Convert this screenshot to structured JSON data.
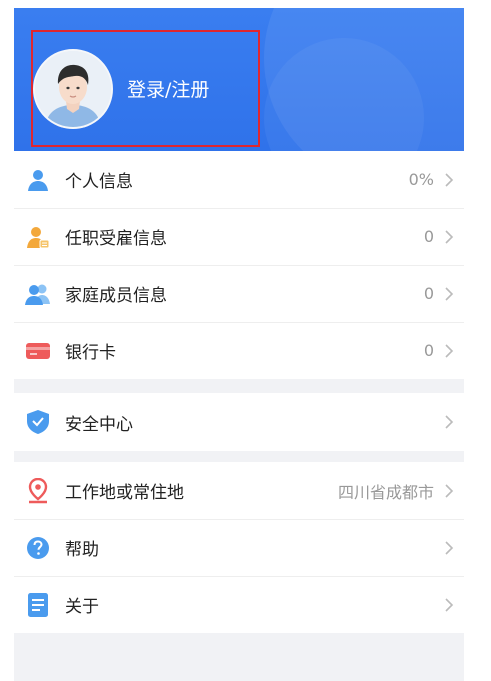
{
  "header": {
    "login_label": "登录/注册"
  },
  "groups": [
    {
      "items": [
        {
          "label": "个人信息",
          "value": "0%"
        },
        {
          "label": "任职受雇信息",
          "value": "0"
        },
        {
          "label": "家庭成员信息",
          "value": "0"
        },
        {
          "label": "银行卡",
          "value": "0"
        }
      ]
    },
    {
      "items": [
        {
          "label": "安全中心",
          "value": ""
        }
      ]
    },
    {
      "items": [
        {
          "label": "工作地或常住地",
          "value": "四川省成都市"
        },
        {
          "label": "帮助",
          "value": ""
        },
        {
          "label": "关于",
          "value": ""
        }
      ]
    }
  ],
  "colors": {
    "header_blue": "#3a7ef0",
    "highlight_red": "#e0262e",
    "icon_blue": "#4a9bee",
    "icon_orange": "#f3a83b",
    "icon_red": "#ee5b5b"
  },
  "icons": {
    "personal_info": "person-icon",
    "employment": "employee-badge-icon",
    "family": "family-icon",
    "bank_card": "bank-card-icon",
    "security": "shield-icon",
    "location": "location-pin-icon",
    "help": "help-icon",
    "about": "document-icon",
    "chevron": "chevron-right-icon"
  }
}
